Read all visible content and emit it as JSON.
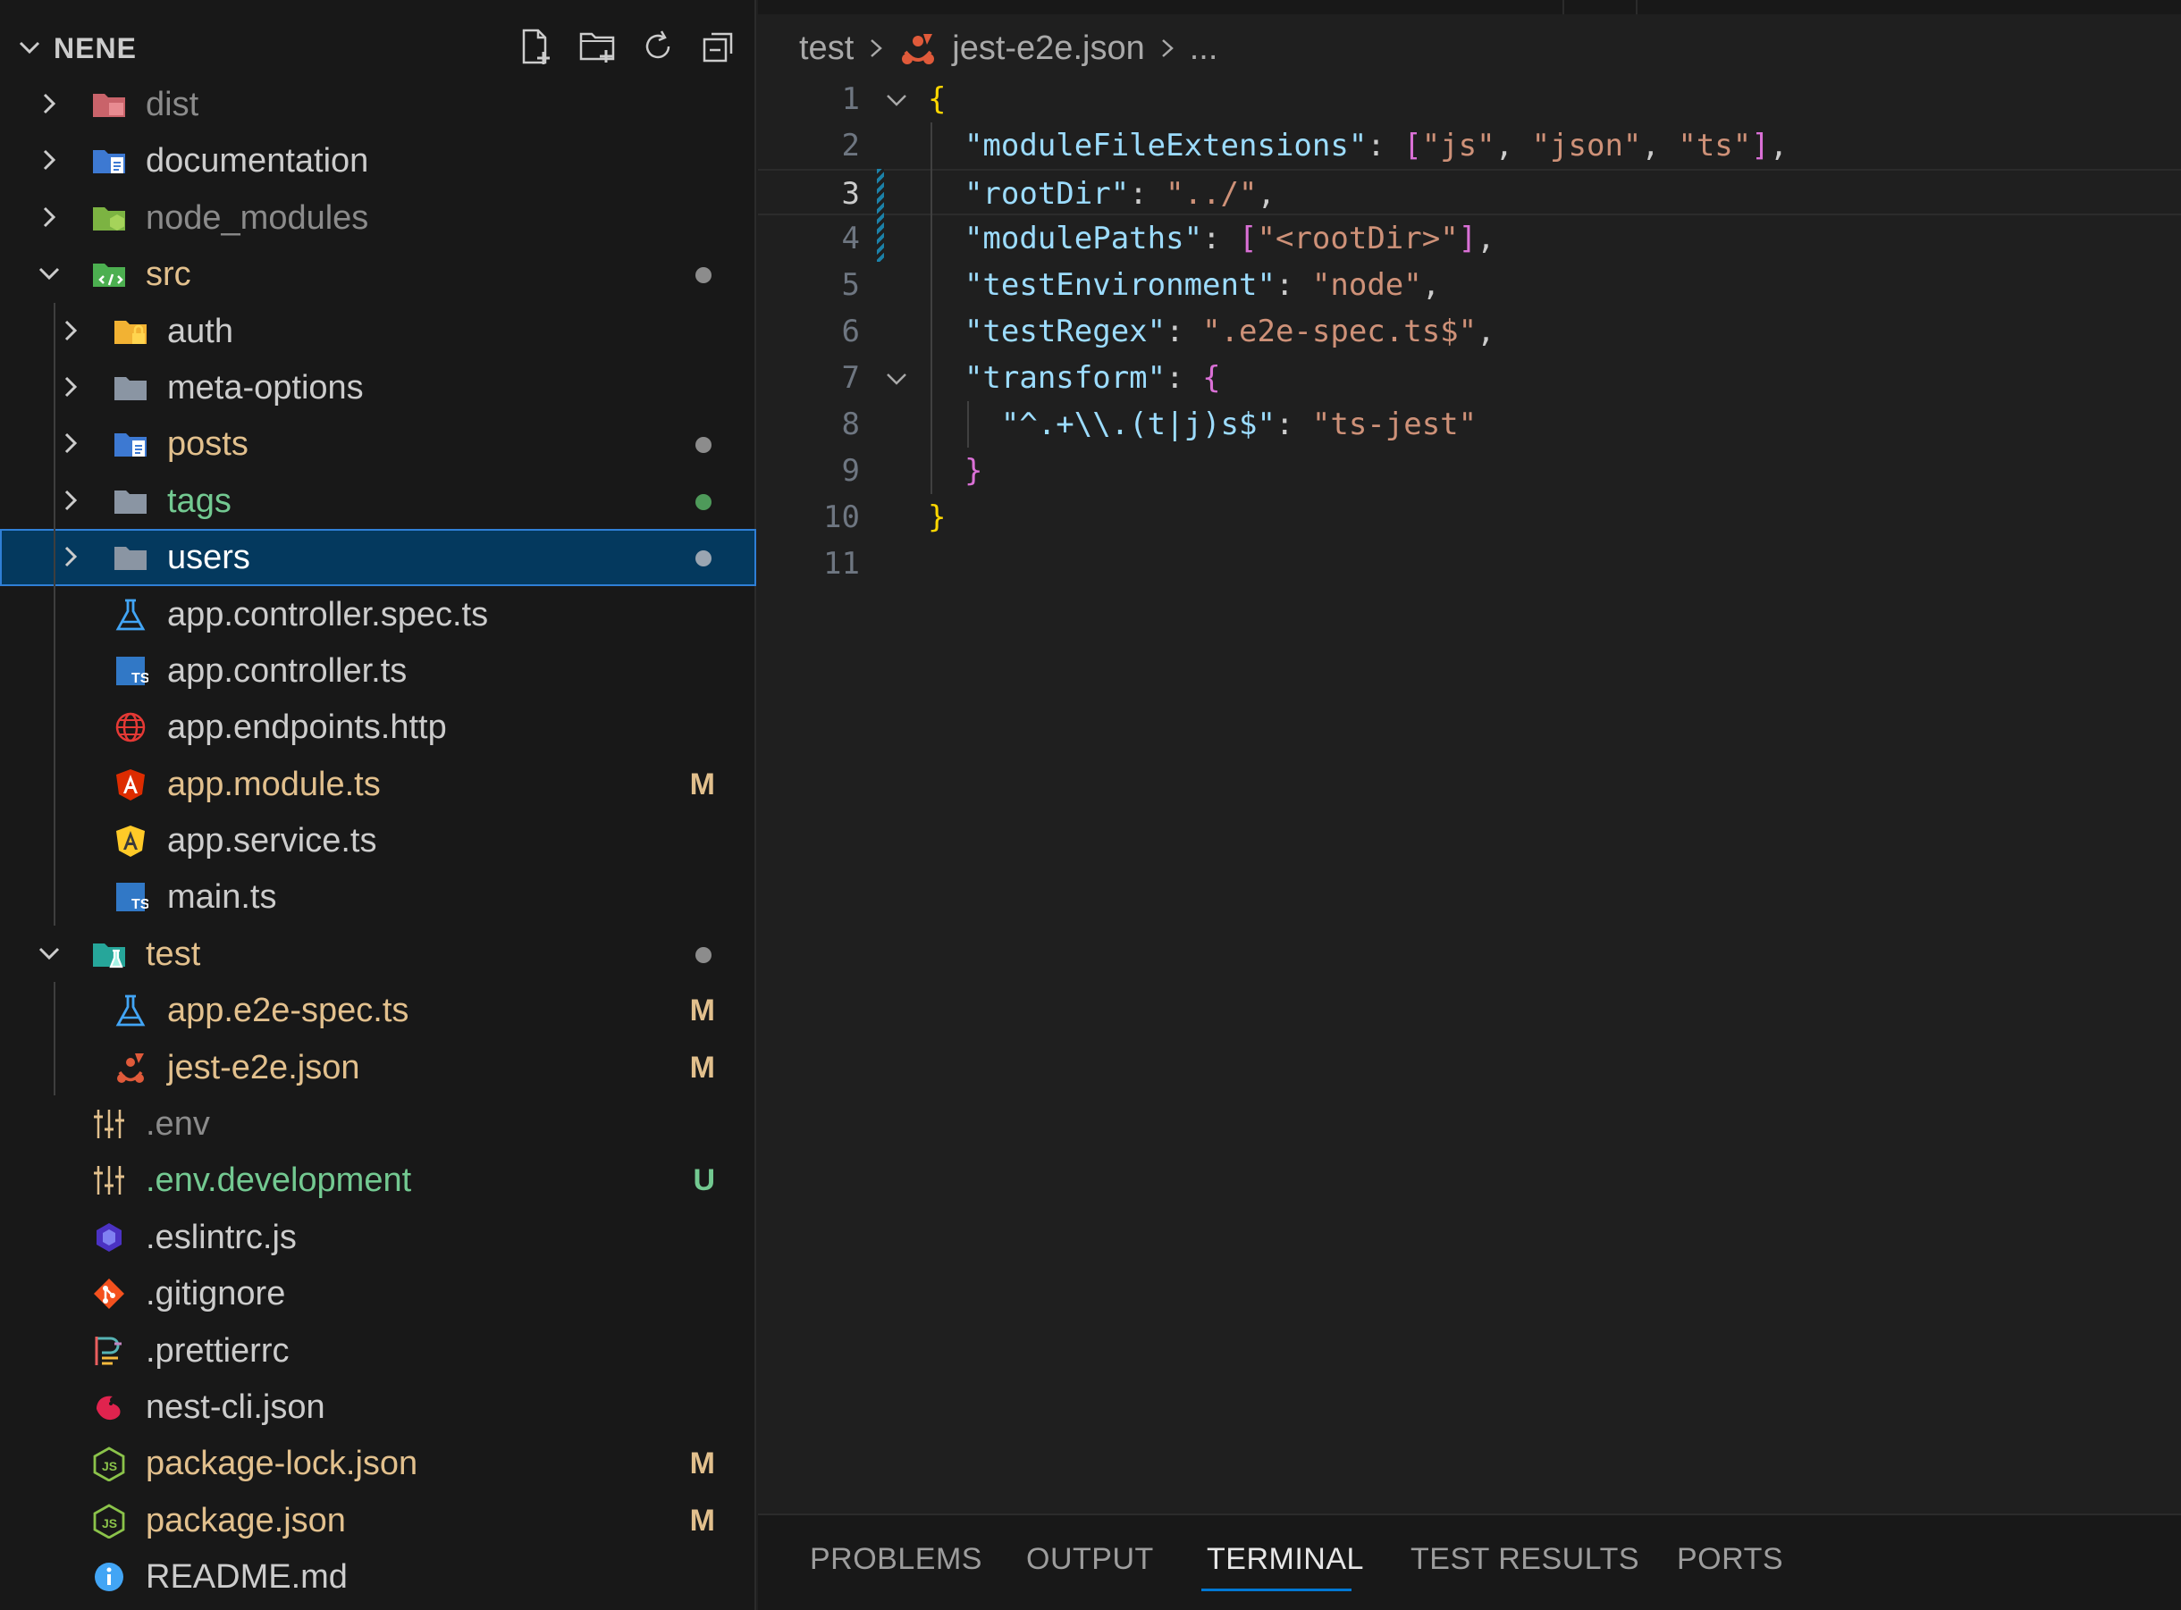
{
  "explorer": {
    "title": "NENE",
    "actions": [
      "new-file-icon",
      "new-folder-icon",
      "refresh-icon",
      "collapse-all-icon"
    ],
    "items": [
      {
        "label": "dist",
        "depth": 0,
        "type": "folder",
        "expanded": false,
        "color": "dim",
        "icon": "folder-dist-icon"
      },
      {
        "label": "documentation",
        "depth": 0,
        "type": "folder",
        "expanded": false,
        "color": "norm",
        "icon": "folder-docs-icon"
      },
      {
        "label": "node_modules",
        "depth": 0,
        "type": "folder",
        "expanded": false,
        "color": "dim",
        "icon": "folder-node-icon"
      },
      {
        "label": "src",
        "depth": 0,
        "type": "folder",
        "expanded": true,
        "color": "mod",
        "icon": "folder-src-icon",
        "dot": "#8c8c8c"
      },
      {
        "label": "auth",
        "depth": 1,
        "type": "folder",
        "expanded": false,
        "color": "norm",
        "icon": "folder-auth-icon"
      },
      {
        "label": "meta-options",
        "depth": 1,
        "type": "folder",
        "expanded": false,
        "color": "norm",
        "icon": "folder-icon"
      },
      {
        "label": "posts",
        "depth": 1,
        "type": "folder",
        "expanded": false,
        "color": "mod",
        "icon": "folder-docs-icon",
        "dot": "#8c8c8c"
      },
      {
        "label": "tags",
        "depth": 1,
        "type": "folder",
        "expanded": false,
        "color": "green",
        "icon": "folder-icon",
        "dot": "#4e9a5a"
      },
      {
        "label": "users",
        "depth": 1,
        "type": "folder",
        "expanded": false,
        "color": "white",
        "icon": "folder-icon",
        "dot": "#9aa5b1",
        "selected": true
      },
      {
        "label": "app.controller.spec.ts",
        "depth": 1,
        "type": "file",
        "color": "norm",
        "icon": "test-flask-icon"
      },
      {
        "label": "app.controller.ts",
        "depth": 1,
        "type": "file",
        "color": "norm",
        "icon": "typescript-icon"
      },
      {
        "label": "app.endpoints.http",
        "depth": 1,
        "type": "file",
        "color": "norm",
        "icon": "globe-icon"
      },
      {
        "label": "app.module.ts",
        "depth": 1,
        "type": "file",
        "color": "mod",
        "icon": "angular-red-icon",
        "badge": "M"
      },
      {
        "label": "app.service.ts",
        "depth": 1,
        "type": "file",
        "color": "norm",
        "icon": "angular-yellow-icon"
      },
      {
        "label": "main.ts",
        "depth": 1,
        "type": "file",
        "color": "norm",
        "icon": "typescript-icon"
      },
      {
        "label": "test",
        "depth": 0,
        "type": "folder",
        "expanded": true,
        "color": "mod",
        "icon": "folder-test-icon",
        "dot": "#8c8c8c"
      },
      {
        "label": "app.e2e-spec.ts",
        "depth": 1,
        "type": "file",
        "color": "mod",
        "icon": "test-flask-icon",
        "badge": "M"
      },
      {
        "label": "jest-e2e.json",
        "depth": 1,
        "type": "file",
        "color": "mod",
        "icon": "jest-icon",
        "badge": "M"
      },
      {
        "label": ".env",
        "depth": 0,
        "type": "file",
        "color": "dim",
        "icon": "env-icon"
      },
      {
        "label": ".env.development",
        "depth": 0,
        "type": "file",
        "color": "green",
        "icon": "env-icon",
        "badge": "U"
      },
      {
        "label": ".eslintrc.js",
        "depth": 0,
        "type": "file",
        "color": "norm",
        "icon": "eslint-icon"
      },
      {
        "label": ".gitignore",
        "depth": 0,
        "type": "file",
        "color": "norm",
        "icon": "git-icon"
      },
      {
        "label": ".prettierrc",
        "depth": 0,
        "type": "file",
        "color": "norm",
        "icon": "prettier-icon"
      },
      {
        "label": "nest-cli.json",
        "depth": 0,
        "type": "file",
        "color": "norm",
        "icon": "nest-icon"
      },
      {
        "label": "package-lock.json",
        "depth": 0,
        "type": "file",
        "color": "mod",
        "icon": "nodejs-icon",
        "badge": "M"
      },
      {
        "label": "package.json",
        "depth": 0,
        "type": "file",
        "color": "mod",
        "icon": "nodejs-icon",
        "badge": "M"
      },
      {
        "label": "README.md",
        "depth": 0,
        "type": "file",
        "color": "norm",
        "icon": "info-icon"
      }
    ]
  },
  "breadcrumb": {
    "folder": "test",
    "file": "jest-e2e.json",
    "more": "..."
  },
  "editor": {
    "current_line": 3,
    "lines": [
      {
        "n": "1",
        "fold": true,
        "tokens": [
          [
            "br1",
            "{"
          ]
        ]
      },
      {
        "n": "2",
        "tokens": [
          [
            "pun",
            "  "
          ],
          [
            "key",
            "\"moduleFileExtensions\""
          ],
          [
            "pun",
            ": "
          ],
          [
            "br2",
            "["
          ],
          [
            "str",
            "\"js\""
          ],
          [
            "pun",
            ", "
          ],
          [
            "str",
            "\"json\""
          ],
          [
            "pun",
            ", "
          ],
          [
            "str",
            "\"ts\""
          ],
          [
            "br2",
            "]"
          ],
          [
            "pun",
            ","
          ]
        ]
      },
      {
        "n": "3",
        "tokens": [
          [
            "pun",
            "  "
          ],
          [
            "key",
            "\"rootDir\""
          ],
          [
            "pun",
            ": "
          ],
          [
            "str",
            "\"../\""
          ],
          [
            "pun",
            ","
          ]
        ]
      },
      {
        "n": "4",
        "tokens": [
          [
            "pun",
            "  "
          ],
          [
            "key",
            "\"modulePaths\""
          ],
          [
            "pun",
            ": "
          ],
          [
            "br2",
            "["
          ],
          [
            "str",
            "\"<rootDir>\""
          ],
          [
            "br2",
            "]"
          ],
          [
            "pun",
            ","
          ]
        ]
      },
      {
        "n": "5",
        "tokens": [
          [
            "pun",
            "  "
          ],
          [
            "key",
            "\"testEnvironment\""
          ],
          [
            "pun",
            ": "
          ],
          [
            "str",
            "\"node\""
          ],
          [
            "pun",
            ","
          ]
        ]
      },
      {
        "n": "6",
        "tokens": [
          [
            "pun",
            "  "
          ],
          [
            "key",
            "\"testRegex\""
          ],
          [
            "pun",
            ": "
          ],
          [
            "str",
            "\".e2e-spec.ts$\""
          ],
          [
            "pun",
            ","
          ]
        ]
      },
      {
        "n": "7",
        "fold": true,
        "tokens": [
          [
            "pun",
            "  "
          ],
          [
            "key",
            "\"transform\""
          ],
          [
            "pun",
            ": "
          ],
          [
            "br2",
            "{"
          ]
        ]
      },
      {
        "n": "8",
        "tokens": [
          [
            "pun",
            "    "
          ],
          [
            "key",
            "\"^.+\\\\.(t|j)s$\""
          ],
          [
            "pun",
            ": "
          ],
          [
            "str",
            "\"ts-jest\""
          ]
        ]
      },
      {
        "n": "9",
        "tokens": [
          [
            "pun",
            "  "
          ],
          [
            "br2",
            "}"
          ]
        ]
      },
      {
        "n": "10",
        "tokens": [
          [
            "br1",
            "}"
          ]
        ]
      },
      {
        "n": "11",
        "tokens": []
      }
    ]
  },
  "panel": {
    "tabs": [
      "PROBLEMS",
      "OUTPUT",
      "TERMINAL",
      "TEST RESULTS",
      "PORTS"
    ],
    "active": "TERMINAL"
  },
  "colors": {
    "accent": "#0078d4",
    "selection": "#04395e",
    "modified": "#e2c08d",
    "untracked": "#73c991"
  }
}
